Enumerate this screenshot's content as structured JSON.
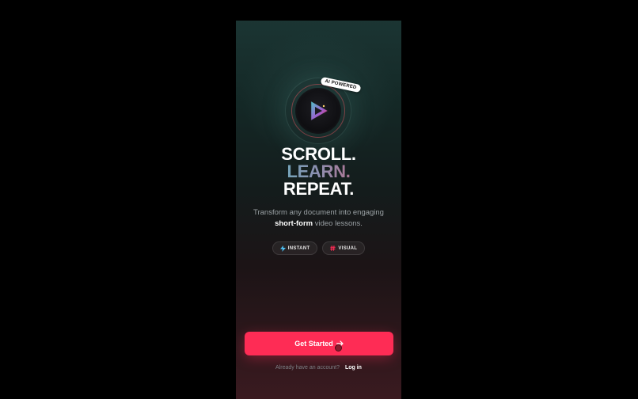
{
  "logo": {
    "badge": "AI POWERED",
    "icon": "play-icon"
  },
  "headline": {
    "line1": "SCROLL.",
    "line2": "LEARN.",
    "line3": "REPEAT."
  },
  "subtitle": {
    "part1": "Transform any document into engaging",
    "highlight": "short-form",
    "part2": "video lessons."
  },
  "chips": [
    {
      "label": "INSTANT",
      "icon": "lightning-icon",
      "color": "#4fc3f7"
    },
    {
      "label": "VISUAL",
      "icon": "hashtag-icon",
      "color": "#fe2c55"
    }
  ],
  "cta": {
    "label": "Get Started",
    "icon": "arrow-right-icon"
  },
  "footer": {
    "prompt": "Already have an account?",
    "login": "Log in"
  },
  "colors": {
    "accent": "#fe2c55",
    "teal": "#4fc3c8",
    "background": "#000000"
  }
}
